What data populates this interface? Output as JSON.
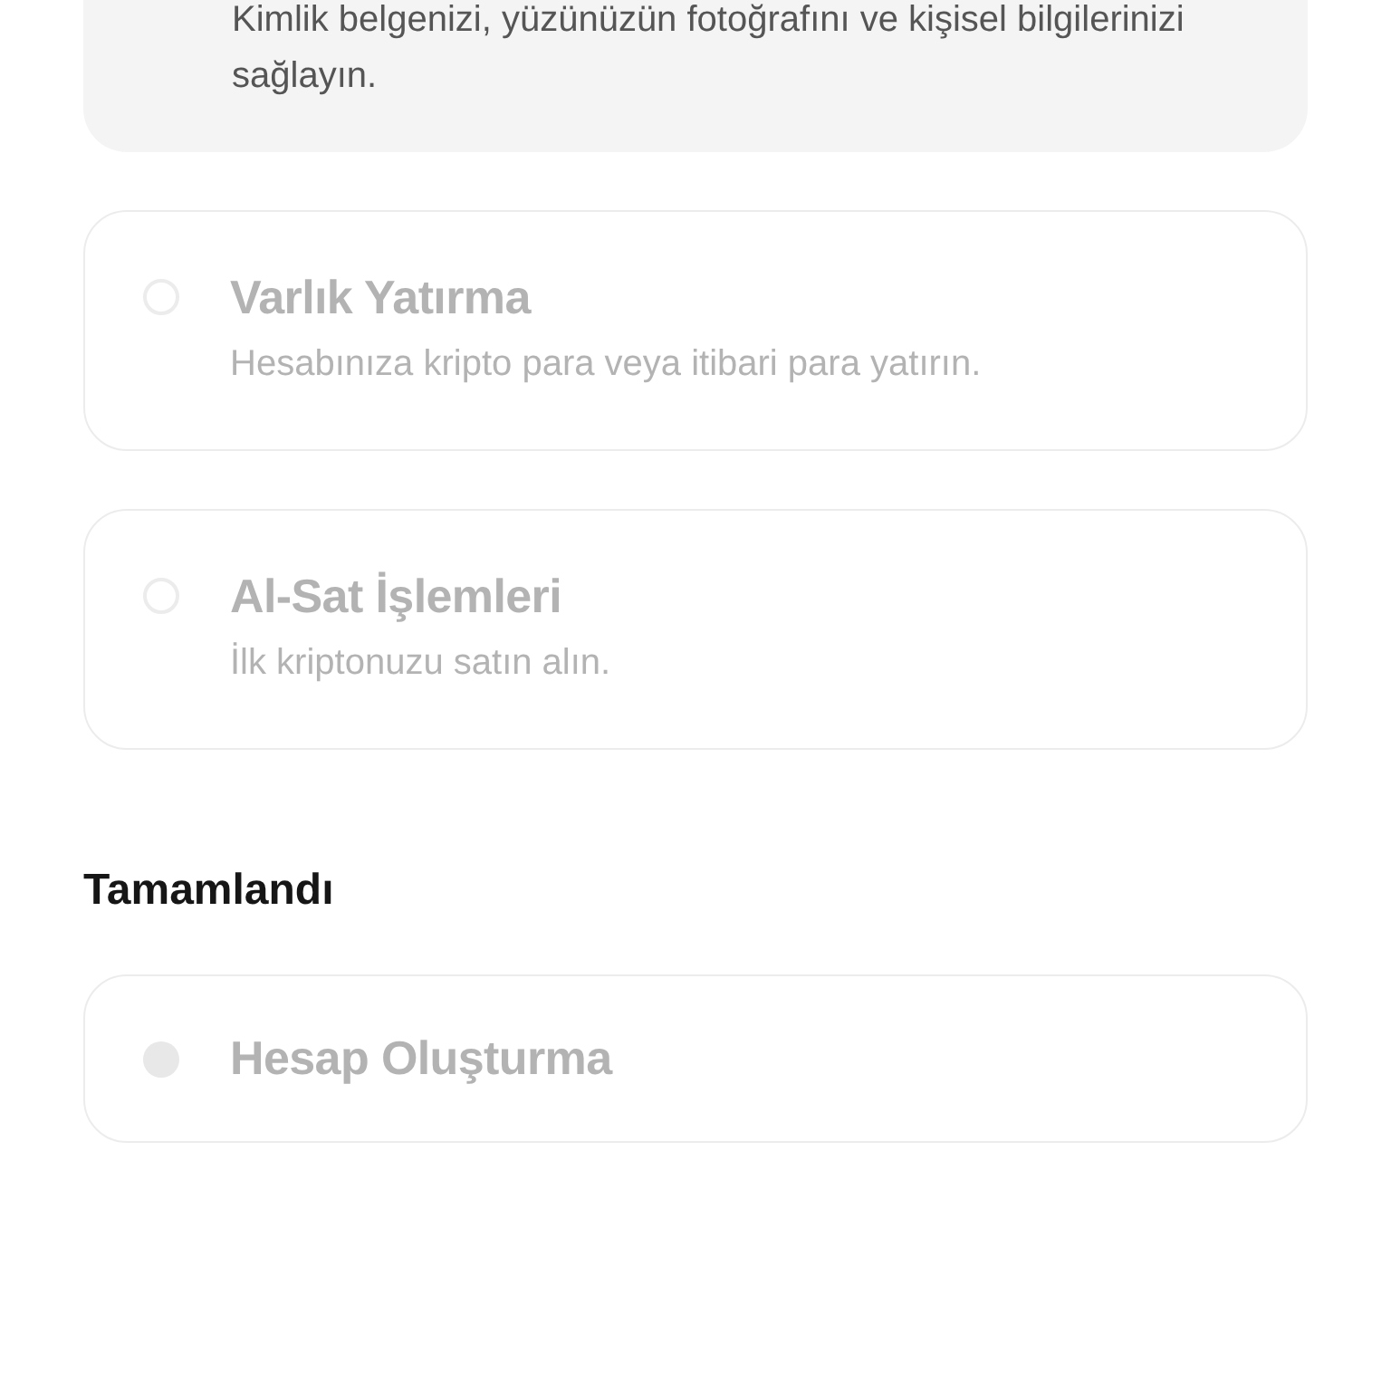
{
  "current_step": {
    "description": "Kimlik belgenizi, yüzünüzün fotoğrafını ve kişisel bilgilerinizi sağlayın."
  },
  "pending_steps": [
    {
      "title": "Varlık Yatırma",
      "description": "Hesabınıza kripto para veya itibari para yatırın.",
      "completed": false
    },
    {
      "title": "Al-Sat İşlemleri",
      "description": "İlk kriptonuzu satın alın.",
      "completed": false
    }
  ],
  "completed_section": {
    "heading": "Tamamlandı",
    "steps": [
      {
        "title": "Hesap Oluşturma",
        "completed": true
      }
    ]
  }
}
